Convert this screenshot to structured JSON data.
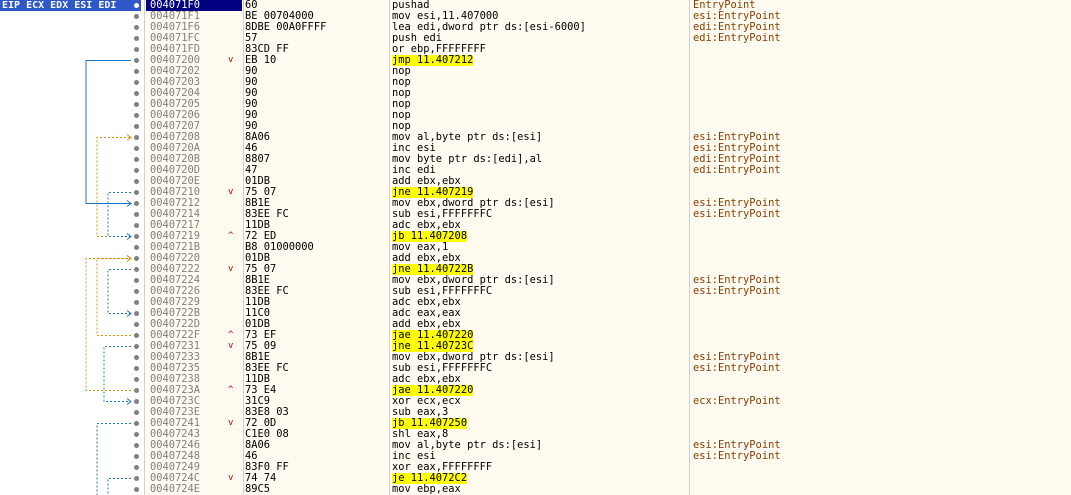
{
  "header": {
    "registers_label": "EIP ECX EDX ESI EDI"
  },
  "rows": [
    {
      "addr": "004071F0",
      "bytes": "60",
      "instr": "pushad",
      "comment": "EntryPoint",
      "current": true
    },
    {
      "addr": "004071F1",
      "bytes": "BE 00704000",
      "instr": "mov esi,11.407000",
      "comment": "esi:EntryPoint"
    },
    {
      "addr": "004071F6",
      "bytes": "8DBE 00A0FFFF",
      "instr": "lea edi,dword ptr ds:[esi-6000]",
      "comment": "edi:EntryPoint"
    },
    {
      "addr": "004071FC",
      "bytes": "57",
      "instr": "push edi",
      "comment": "edi:EntryPoint"
    },
    {
      "addr": "004071FD",
      "bytes": "83CD FF",
      "instr": "or ebp,FFFFFFFF",
      "comment": ""
    },
    {
      "addr": "00407200",
      "bytes": "EB 10",
      "instr": "jmp 11.407212",
      "comment": "",
      "jump": "v",
      "hl": true
    },
    {
      "addr": "00407202",
      "bytes": "90",
      "instr": "nop",
      "comment": ""
    },
    {
      "addr": "00407203",
      "bytes": "90",
      "instr": "nop",
      "comment": ""
    },
    {
      "addr": "00407204",
      "bytes": "90",
      "instr": "nop",
      "comment": ""
    },
    {
      "addr": "00407205",
      "bytes": "90",
      "instr": "nop",
      "comment": ""
    },
    {
      "addr": "00407206",
      "bytes": "90",
      "instr": "nop",
      "comment": ""
    },
    {
      "addr": "00407207",
      "bytes": "90",
      "instr": "nop",
      "comment": ""
    },
    {
      "addr": "00407208",
      "bytes": "8A06",
      "instr": "mov al,byte ptr ds:[esi]",
      "comment": "esi:EntryPoint"
    },
    {
      "addr": "0040720A",
      "bytes": "46",
      "instr": "inc esi",
      "comment": "esi:EntryPoint"
    },
    {
      "addr": "0040720B",
      "bytes": "8807",
      "instr": "mov byte ptr ds:[edi],al",
      "comment": "edi:EntryPoint"
    },
    {
      "addr": "0040720D",
      "bytes": "47",
      "instr": "inc edi",
      "comment": "edi:EntryPoint"
    },
    {
      "addr": "0040720E",
      "bytes": "01DB",
      "instr": "add ebx,ebx",
      "comment": ""
    },
    {
      "addr": "00407210",
      "bytes": "75 07",
      "instr": "jne 11.407219",
      "comment": "",
      "jump": "v",
      "hl": true
    },
    {
      "addr": "00407212",
      "bytes": "8B1E",
      "instr": "mov ebx,dword ptr ds:[esi]",
      "comment": "esi:EntryPoint"
    },
    {
      "addr": "00407214",
      "bytes": "83EE FC",
      "instr": "sub esi,FFFFFFFC",
      "comment": "esi:EntryPoint"
    },
    {
      "addr": "00407217",
      "bytes": "11DB",
      "instr": "adc ebx,ebx",
      "comment": ""
    },
    {
      "addr": "00407219",
      "bytes": "72 ED",
      "instr": "jb 11.407208",
      "comment": "",
      "jump": "^",
      "hl": true
    },
    {
      "addr": "0040721B",
      "bytes": "B8 01000000",
      "instr": "mov eax,1",
      "comment": ""
    },
    {
      "addr": "00407220",
      "bytes": "01DB",
      "instr": "add ebx,ebx",
      "comment": ""
    },
    {
      "addr": "00407222",
      "bytes": "75 07",
      "instr": "jne 11.40722B",
      "comment": "",
      "jump": "v",
      "hl": true
    },
    {
      "addr": "00407224",
      "bytes": "8B1E",
      "instr": "mov ebx,dword ptr ds:[esi]",
      "comment": "esi:EntryPoint"
    },
    {
      "addr": "00407226",
      "bytes": "83EE FC",
      "instr": "sub esi,FFFFFFFC",
      "comment": "esi:EntryPoint"
    },
    {
      "addr": "00407229",
      "bytes": "11DB",
      "instr": "adc ebx,ebx",
      "comment": ""
    },
    {
      "addr": "0040722B",
      "bytes": "11C0",
      "instr": "adc eax,eax",
      "comment": ""
    },
    {
      "addr": "0040722D",
      "bytes": "01DB",
      "instr": "add ebx,ebx",
      "comment": ""
    },
    {
      "addr": "0040722F",
      "bytes": "73 EF",
      "instr": "jae 11.407220",
      "comment": "",
      "jump": "^",
      "hl": true
    },
    {
      "addr": "00407231",
      "bytes": "75 09",
      "instr": "jne 11.40723C",
      "comment": "",
      "jump": "v",
      "hl": true
    },
    {
      "addr": "00407233",
      "bytes": "8B1E",
      "instr": "mov ebx,dword ptr ds:[esi]",
      "comment": "esi:EntryPoint"
    },
    {
      "addr": "00407235",
      "bytes": "83EE FC",
      "instr": "sub esi,FFFFFFFC",
      "comment": "esi:EntryPoint"
    },
    {
      "addr": "00407238",
      "bytes": "11DB",
      "instr": "adc ebx,ebx",
      "comment": ""
    },
    {
      "addr": "0040723A",
      "bytes": "73 E4",
      "instr": "jae 11.407220",
      "comment": "",
      "jump": "^",
      "hl": true
    },
    {
      "addr": "0040723C",
      "bytes": "31C9",
      "instr": "xor ecx,ecx",
      "comment": "ecx:EntryPoint"
    },
    {
      "addr": "0040723E",
      "bytes": "83E8 03",
      "instr": "sub eax,3",
      "comment": ""
    },
    {
      "addr": "00407241",
      "bytes": "72 0D",
      "instr": "jb 11.407250",
      "comment": "",
      "jump": "v",
      "hl": true
    },
    {
      "addr": "00407243",
      "bytes": "C1E0 08",
      "instr": "shl eax,8",
      "comment": ""
    },
    {
      "addr": "00407246",
      "bytes": "8A06",
      "instr": "mov al,byte ptr ds:[esi]",
      "comment": "esi:EntryPoint"
    },
    {
      "addr": "00407248",
      "bytes": "46",
      "instr": "inc esi",
      "comment": "esi:EntryPoint"
    },
    {
      "addr": "00407249",
      "bytes": "83F0 FF",
      "instr": "xor eax,FFFFFFFF",
      "comment": ""
    },
    {
      "addr": "0040724C",
      "bytes": "74 74",
      "instr": "je 11.4072C2",
      "comment": "",
      "jump": "v",
      "hl": true
    },
    {
      "addr": "0040724E",
      "bytes": "89C5",
      "instr": "mov ebp,eax",
      "comment": ""
    }
  ],
  "colors": {
    "current_row_bg": "#000080",
    "eip_label_bg": "#2e57c9",
    "jump_highlight": "#ffff00",
    "comment_color": "#8a3c00",
    "branch_blue": "#1e78c8",
    "branch_orange": "#e09010"
  }
}
